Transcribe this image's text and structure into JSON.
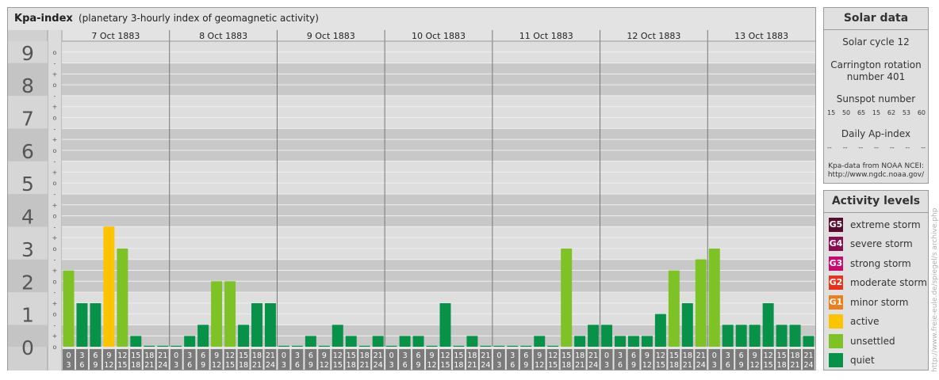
{
  "title": "Kpa-index",
  "subtitle": "(planetary 3-hourly index of geomagnetic activity)",
  "chart_data": {
    "type": "bar",
    "title": "Kpa-index",
    "subtitle": "(planetary 3-hourly index of geomagnetic activity)",
    "ylim": [
      0,
      9
    ],
    "y_tick_labels": [
      "0",
      "1",
      "2",
      "3",
      "4",
      "5",
      "6",
      "7",
      "8",
      "9"
    ],
    "minor_tick_labels": [
      "o",
      "+",
      "-",
      "o",
      "+",
      "-",
      "o",
      "+",
      "-",
      "o",
      "+",
      "-",
      "o",
      "+",
      "-",
      "o",
      "+",
      "-",
      "o",
      "+",
      "-",
      "o",
      "+",
      "-",
      "o",
      "+",
      "-",
      "o"
    ],
    "days": [
      "7 Oct 1883",
      "8 Oct 1883",
      "9 Oct 1883",
      "10 Oct 1883",
      "11 Oct 1883",
      "12 Oct 1883",
      "13 Oct 1883"
    ],
    "slot_labels": [
      [
        "0",
        "3"
      ],
      [
        "3",
        "6"
      ],
      [
        "6",
        "9"
      ],
      [
        "9",
        "12"
      ],
      [
        "12",
        "15"
      ],
      [
        "15",
        "18"
      ],
      [
        "18",
        "21"
      ],
      [
        "21",
        "24"
      ]
    ],
    "values": [
      2.33,
      1.33,
      1.33,
      3.67,
      3.0,
      0.33,
      0.0,
      0.0,
      0.0,
      0.33,
      0.67,
      2.0,
      2.0,
      0.67,
      1.33,
      1.33,
      0.0,
      0.0,
      0.33,
      0.0,
      0.67,
      0.33,
      0.0,
      0.33,
      0.0,
      0.33,
      0.33,
      0.0,
      1.33,
      0.0,
      0.33,
      0.0,
      0.0,
      0.0,
      0.0,
      0.33,
      0.0,
      3.0,
      0.33,
      0.67,
      0.67,
      0.33,
      0.33,
      0.33,
      1.0,
      2.33,
      1.33,
      2.67,
      3.0,
      0.67,
      0.67,
      0.67,
      1.33,
      0.67,
      0.67,
      0.33
    ],
    "level_colors": {
      "quiet": "#089148",
      "unsettled": "#7ec225",
      "active": "#fcc400"
    },
    "grid": true
  },
  "solar": {
    "heading": "Solar data",
    "cycle": "Solar cycle 12",
    "carrington_line1": "Carrington rotation",
    "carrington_line2": "number 401",
    "sunspot_label": "Sunspot number",
    "sunspot_values": [
      "15",
      "50",
      "65",
      "15",
      "62",
      "53",
      "60"
    ],
    "ap_label": "Daily Ap-index",
    "ap_values": [
      "--",
      "--",
      "--",
      "--",
      "--",
      "--",
      "--"
    ],
    "source_line1": "Kpa-data from NOAA NCEI:",
    "source_line2": "http://www.ngdc.noaa.gov/"
  },
  "levels": {
    "heading": "Activity levels",
    "items": [
      {
        "badge": "G5",
        "label": "extreme storm",
        "color": "#5a0a2e"
      },
      {
        "badge": "G4",
        "label": "severe storm",
        "color": "#8c0a50"
      },
      {
        "badge": "G3",
        "label": "strong storm",
        "color": "#c80a6e"
      },
      {
        "badge": "G2",
        "label": "moderate storm",
        "color": "#e8331c"
      },
      {
        "badge": "G1",
        "label": "minor storm",
        "color": "#ef7d1a"
      },
      {
        "badge": "",
        "label": "active",
        "color": "#fcc400"
      },
      {
        "badge": "",
        "label": "unsettled",
        "color": "#7ec225"
      },
      {
        "badge": "",
        "label": "quiet",
        "color": "#089148"
      }
    ]
  },
  "watermark": "http://www.freie-eule.de/spiegel/s archive.php"
}
